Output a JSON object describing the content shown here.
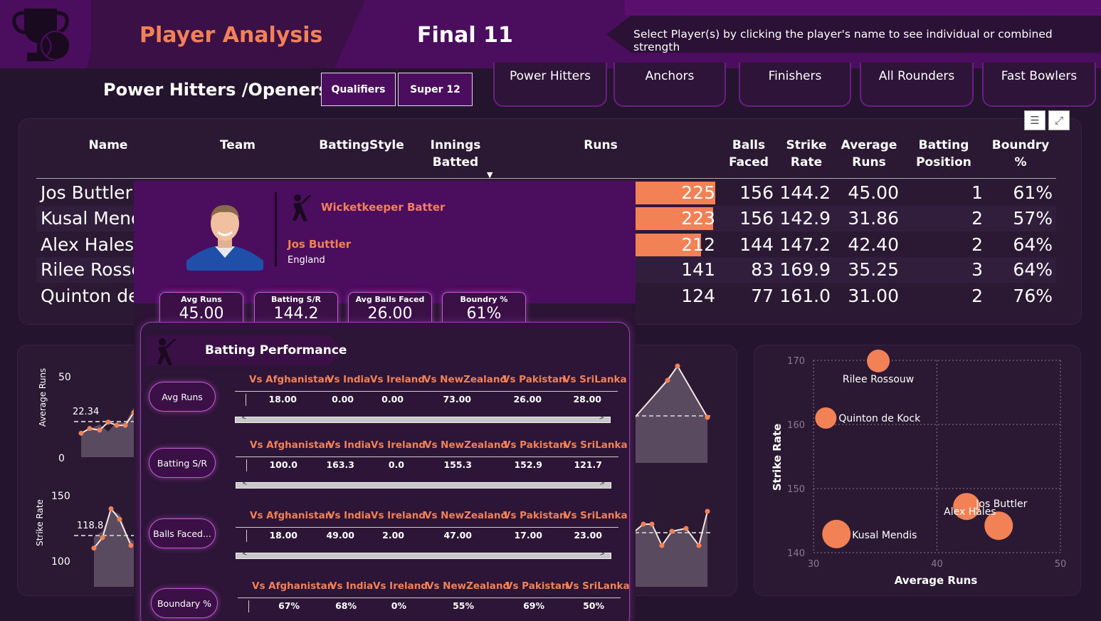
{
  "header": {
    "page_title": "Player Analysis",
    "final_title": "Final 11",
    "info_text": "Select Player(s) by clicking the player's name to see individual or combined strength"
  },
  "section_title": "Power Hitters /Openers",
  "stage_buttons": [
    "Qualifiers",
    "Super 12"
  ],
  "category_tabs": [
    "Power Hitters",
    "Anchors",
    "Finishers",
    "All Rounders",
    "Fast Bowlers"
  ],
  "table": {
    "columns": {
      "name": "Name",
      "team": "Team",
      "batting_style": "BattingStyle",
      "innings_1": "Innings",
      "innings_2": "Batted",
      "runs": "Runs",
      "balls_1": "Balls",
      "balls_2": "Faced",
      "sr_1": "Strike",
      "sr_2": "Rate",
      "avg_1": "Average",
      "avg_2": "Runs",
      "pos_1": "Batting",
      "pos_2": "Position",
      "bnd_1": "Boundry",
      "bnd_2": "%"
    },
    "rows": [
      {
        "name": "Jos Buttler",
        "runs": "225",
        "runs_value": 225,
        "balls": "156",
        "sr": "144.2",
        "avg": "45.00",
        "pos": "1",
        "bnd": "61%"
      },
      {
        "name": "Kusal Mendis",
        "runs": "223",
        "runs_value": 223,
        "balls": "156",
        "sr": "142.9",
        "avg": "31.86",
        "pos": "2",
        "bnd": "57%"
      },
      {
        "name": "Alex Hales",
        "runs": "212",
        "runs_value": 212,
        "balls": "144",
        "sr": "147.2",
        "avg": "42.40",
        "pos": "2",
        "bnd": "64%"
      },
      {
        "name": "Rilee Rossouw",
        "runs": "141",
        "runs_value": 141,
        "balls": "83",
        "sr": "169.9",
        "avg": "35.25",
        "pos": "3",
        "bnd": "64%"
      },
      {
        "name": "Quinton de Kock",
        "runs": "124",
        "runs_value": 124,
        "balls": "77",
        "sr": "161.0",
        "avg": "31.00",
        "pos": "2",
        "bnd": "76%"
      }
    ]
  },
  "tooltip": {
    "role": "Wicketkeeper Batter",
    "player_name": "Jos Buttler",
    "country": "England",
    "kpis": [
      {
        "label": "Avg Runs",
        "value": "45.00"
      },
      {
        "label": "Batting S/R",
        "value": "144.2"
      },
      {
        "label": "Avg Balls Faced",
        "value": "26.00"
      },
      {
        "label": "Boundry %",
        "value": "61%"
      }
    ],
    "performance_title": "Batting Performance",
    "opponents": [
      "Vs Afghanistan",
      "Vs India",
      "Vs Ireland",
      "Vs NewZealand",
      "Vs Pakistan",
      "Vs SriLanka"
    ],
    "metrics": [
      {
        "label": "Avg Runs",
        "values": [
          "18.00",
          "0.00",
          "0.00",
          "73.00",
          "26.00",
          "28.00"
        ]
      },
      {
        "label": "Batting S/R",
        "values": [
          "100.0",
          "163.3",
          "0.0",
          "155.3",
          "152.9",
          "121.7"
        ]
      },
      {
        "label": "Balls Faced...",
        "values": [
          "18.00",
          "49.00",
          "2.00",
          "47.00",
          "17.00",
          "23.00"
        ]
      },
      {
        "label": "Boundary %",
        "values": [
          "67%",
          "68%",
          "0%",
          "55%",
          "69%",
          "50%"
        ]
      }
    ]
  },
  "line_charts": {
    "avg": {
      "ylabel": "Average Runs",
      "y_top": "50",
      "y_bottom": "0",
      "ref_value": "22.34",
      "visible_points": [
        15,
        18,
        17,
        22,
        20,
        20,
        28
      ]
    },
    "sr": {
      "ylabel": "Strike Rate",
      "y_top": "150",
      "y_bottom": "100",
      "ref_value": "118.8",
      "visible_points": [
        110,
        118,
        140,
        132,
        112
      ]
    }
  },
  "chart_data": {
    "type": "scatter",
    "xlabel": "Average Runs",
    "ylabel": "Strike Rate",
    "xlim": [
      30,
      50
    ],
    "ylim": [
      140,
      170
    ],
    "x_ticks": [
      "30",
      "40",
      "50"
    ],
    "y_ticks": [
      "140",
      "150",
      "160",
      "170"
    ],
    "points": [
      {
        "label": "Rilee Rossouw",
        "x": 35.25,
        "y": 169.9
      },
      {
        "label": "Quinton de Kock",
        "x": 31.0,
        "y": 161.0
      },
      {
        "label": "Jos Buttler",
        "x": 45.0,
        "y": 144.2
      },
      {
        "label": "Alex Hales",
        "x": 42.4,
        "y": 147.2
      },
      {
        "label": "Kusal Mendis",
        "x": 31.86,
        "y": 142.9
      }
    ],
    "colors": {
      "marker": "#f28155"
    }
  },
  "colors": {
    "accent": "#f28155",
    "header": "#4b0d5e",
    "background": "#24142e",
    "panel": "#2b1934"
  }
}
